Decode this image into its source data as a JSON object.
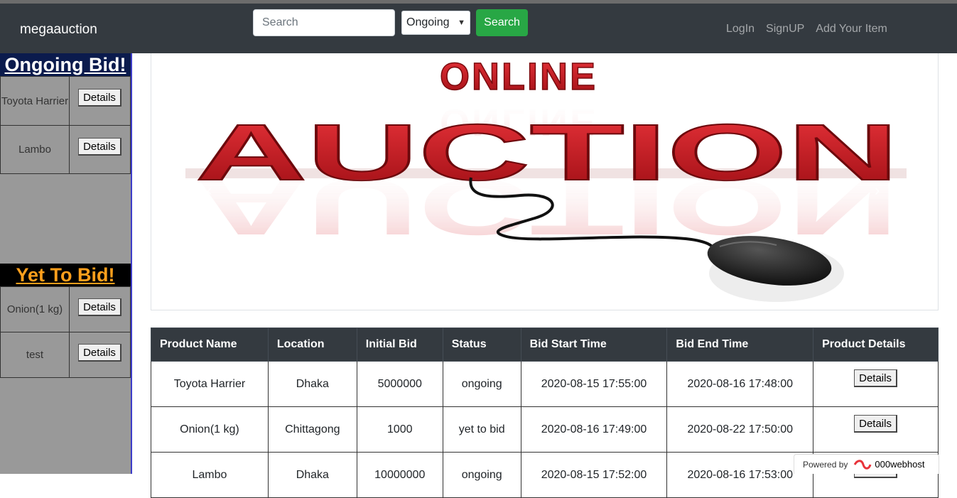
{
  "navbar": {
    "brand": "megaauction",
    "search_placeholder": "Search",
    "filter_selected": "Ongoing",
    "search_button": "Search",
    "links": [
      "LogIn",
      "SignUP",
      "Add Your Item"
    ]
  },
  "sidebar": {
    "ongoing_title": "Ongoing Bid!",
    "ongoing_items": [
      {
        "name": "Toyota Harrier",
        "button": "Details"
      },
      {
        "name": "Lambo",
        "button": "Details"
      }
    ],
    "yet_title": "Yet To Bid!",
    "yet_items": [
      {
        "name": "Onion(1 kg)",
        "button": "Details"
      },
      {
        "name": "test",
        "button": "Details"
      }
    ]
  },
  "banner": {
    "line1": "ONLINE",
    "line2": "AUCTION",
    "prev": "‹",
    "next": "›"
  },
  "table": {
    "headers": [
      "Product Name",
      "Location",
      "Initial Bid",
      "Status",
      "Bid Start Time",
      "Bid End Time",
      "Product Details"
    ],
    "rows": [
      [
        "Toyota Harrier",
        "Dhaka",
        "5000000",
        "ongoing",
        "2020-08-15 17:55:00",
        "2020-08-16 17:48:00",
        "Details"
      ],
      [
        "Onion(1 kg)",
        "Chittagong",
        "1000",
        "yet to bid",
        "2020-08-16 17:49:00",
        "2020-08-22 17:50:00",
        "Details"
      ],
      [
        "Lambo",
        "Dhaka",
        "10000000",
        "ongoing",
        "2020-08-15 17:52:00",
        "2020-08-16 17:53:00",
        "Details"
      ]
    ]
  },
  "badge": {
    "powered": "Powered by",
    "host": "000webhost"
  },
  "colors": {
    "navbar": "#343a40",
    "sidebar": "#999999",
    "search_button": "#28a745",
    "yet_heading": "#ff9f1c",
    "banner_red": "#c8161d"
  }
}
